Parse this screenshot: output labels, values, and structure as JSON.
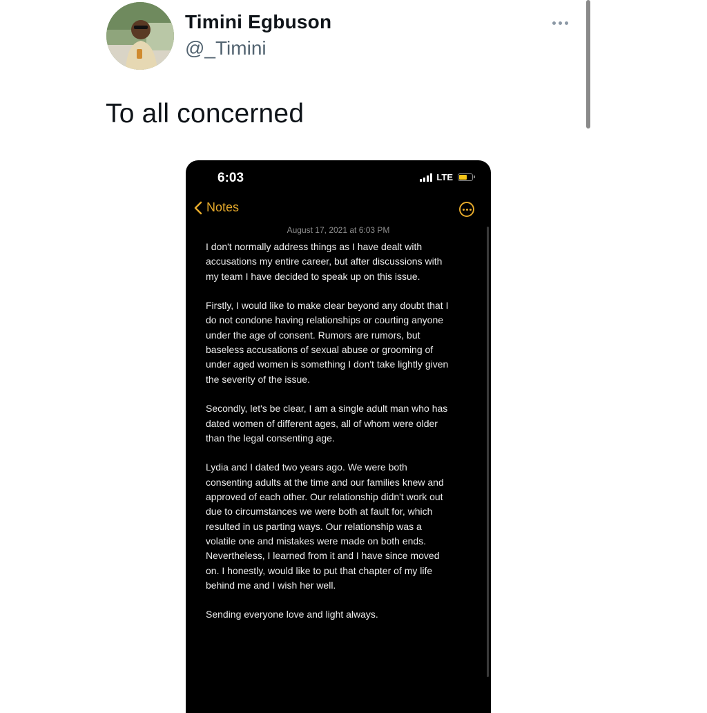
{
  "tweet": {
    "author": {
      "display_name": "Timini Egbuson",
      "handle": "@_Timini"
    },
    "text": "To all concerned",
    "more_icon": "ellipsis-icon"
  },
  "screenshot": {
    "status_bar": {
      "time": "6:03",
      "network": "LTE",
      "battery_color": "#f5c518"
    },
    "nav": {
      "back_label": "Notes",
      "accent_color": "#e5a92b"
    },
    "note": {
      "date": "August 17, 2021 at 6:03 PM",
      "paragraphs": [
        "I don't normally address things as I have dealt with\naccusations my entire career, but after discussions with\nmy team I have decided to speak up on this issue.",
        "Firstly, I would like to make clear beyond any doubt that I\ndo not condone having relationships or courting anyone\nunder the age of consent. Rumors are rumors, but\nbaseless accusations of sexual abuse or grooming of\nunder aged women is something I don't take lightly given\nthe severity of the issue.",
        "Secondly, let's be clear, I am a single adult man who has\ndated women of different ages, all of whom were older\nthan the legal consenting age.",
        "Lydia and I dated two years ago. We were both\nconsenting adults at the time and our families knew and\napproved of each other. Our relationship didn't work out\ndue to circumstances we were both at fault for, which\nresulted in us parting ways. Our relationship was a\nvolatile one and mistakes were made on both ends.\nNevertheless, I learned from it and I have since moved\non. I honestly, would like to put that chapter of my life\nbehind me and I wish her well.",
        "Sending everyone love and light always."
      ]
    }
  }
}
